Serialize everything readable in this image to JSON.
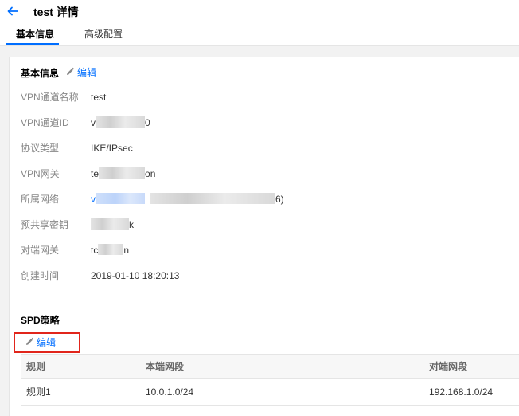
{
  "header": {
    "title": "test 详情",
    "back_icon": "arrow-left-icon",
    "accent_color": "#006eff"
  },
  "tabs": [
    {
      "label": "基本信息",
      "active": true
    },
    {
      "label": "高级配置",
      "active": false
    }
  ],
  "basic_info": {
    "title": "基本信息",
    "edit_label": "编辑",
    "rows": [
      {
        "label": "VPN通道名称",
        "value": "test"
      },
      {
        "label": "VPN通道ID",
        "value_prefix": "v",
        "value_suffix": "0"
      },
      {
        "label": "协议类型",
        "value": "IKE/IPsec"
      },
      {
        "label": "VPN网关",
        "value_prefix": "te",
        "value_suffix": "on"
      },
      {
        "label": "所属网络",
        "value_prefix": "v",
        "value_suffix": "6)"
      },
      {
        "label": "预共享密钥",
        "value_suffix": "k"
      },
      {
        "label": "对端网关",
        "value_prefix": "tc",
        "value_suffix": "n"
      },
      {
        "label": "创建时间",
        "value": "2019-01-10 18:20:13"
      }
    ]
  },
  "spd": {
    "title": "SPD策略",
    "edit_label": "编辑",
    "highlight_color": "#e1251b",
    "columns": [
      "规则",
      "本端网段",
      "对端网段"
    ],
    "rows": [
      {
        "rule": "规则1",
        "local": "10.0.1.0/24",
        "remote": "192.168.1.0/24"
      }
    ]
  }
}
